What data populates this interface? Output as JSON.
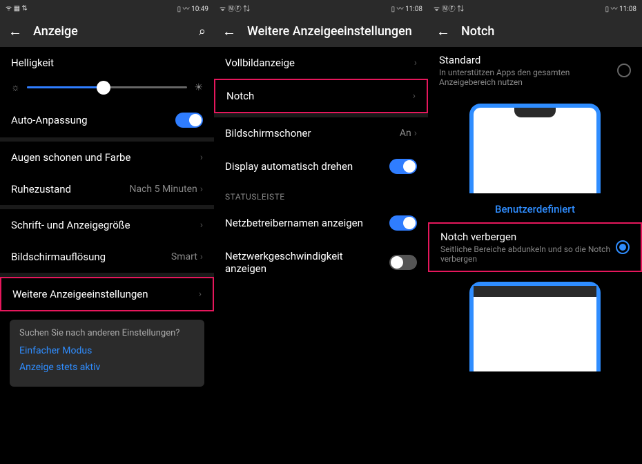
{
  "phone1": {
    "status": {
      "left": "ᯤ ▦ ⇅",
      "right": "▯ 〰 10:49"
    },
    "title": "Anzeige",
    "brightness_label": "Helligkeit",
    "auto_adjust": "Auto-Anpassung",
    "rows": {
      "eyes": "Augen schonen und Farbe",
      "sleep": "Ruhezustand",
      "sleep_val": "Nach 5 Minuten",
      "font": "Schrift- und Anzeigegröße",
      "resolution": "Bildschirmauflösung",
      "resolution_val": "Smart",
      "more": "Weitere Anzeigeeinstellungen"
    },
    "suggest": {
      "question": "Suchen Sie nach anderen Einstellungen?",
      "link1": "Einfacher Modus",
      "link2": "Anzeige stets aktiv"
    }
  },
  "phone2": {
    "status": {
      "left": "ᯤ ⓃⒻ ⇅",
      "right": "▯ 〰 11:08"
    },
    "title": "Weitere Anzeigeeinstellungen",
    "rows": {
      "fullscreen": "Vollbildanzeige",
      "notch": "Notch",
      "screensaver": "Bildschirmschoner",
      "screensaver_val": "An",
      "rotate": "Display automatisch drehen",
      "section": "STATUSLEISTE",
      "carrier": "Netzbetreibernamen anzeigen",
      "netspeed": "Netzwerkgeschwindigkeit anzeigen"
    }
  },
  "phone3": {
    "status": {
      "left": "ᯤ ⓃⒻ ⇅",
      "right": "▯ 〰 11:08"
    },
    "title": "Notch",
    "standard": {
      "title": "Standard",
      "sub": "In unterstützen Apps den gesamten Anzeigebereich nutzen"
    },
    "custom_label": "Benutzerdefiniert",
    "hide": {
      "title": "Notch verbergen",
      "sub": "Seitliche Bereiche abdunkeln und so die Notch verbergen"
    }
  }
}
